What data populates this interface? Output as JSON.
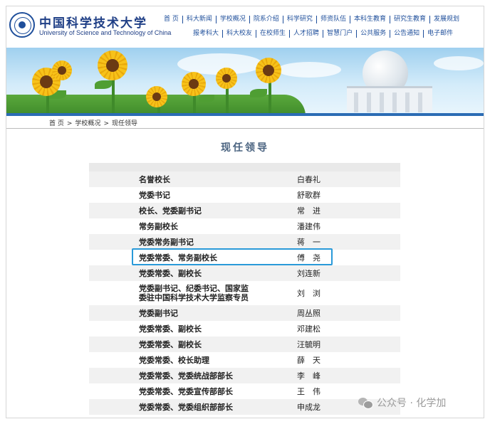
{
  "header": {
    "brand_cn": "中国科学技术大学",
    "brand_en": "University of Science and Technology of China",
    "logo_icon": "ustc-seal-icon"
  },
  "nav": {
    "row1": [
      "首 页",
      "科大新闻",
      "学校概况",
      "院系介绍",
      "科学研究",
      "师资队伍",
      "本科生教育",
      "研究生教育",
      "发展规划"
    ],
    "row2": [
      "报考科大",
      "科大校友",
      "在校师生",
      "人才招聘",
      "智慧门户",
      "公共服务",
      "公告通知",
      "电子邮件"
    ]
  },
  "breadcrumb": [
    "首 页",
    "学校概况",
    "现任领导"
  ],
  "breadcrumb_sep": ">",
  "page_title": "现任领导",
  "leaders": [
    {
      "title": "名誉校长",
      "name": "白春礼"
    },
    {
      "title": "党委书记",
      "name": "舒歌群"
    },
    {
      "title": "校长、党委副书记",
      "name": "常　进"
    },
    {
      "title": "常务副校长",
      "name": "潘建伟"
    },
    {
      "title": "党委常务副书记",
      "name": "蒋　一"
    },
    {
      "title": "党委常委、常务副校长",
      "name": "傅　尧"
    },
    {
      "title": "党委常委、副校长",
      "name": "刘连新"
    },
    {
      "title": "党委副书记、纪委书记、国家监委驻中国科学技术大学监察专员",
      "name": "刘　浏"
    },
    {
      "title": "党委副书记",
      "name": "周丛照"
    },
    {
      "title": "党委常委、副校长",
      "name": "邓建松"
    },
    {
      "title": "党委常委、副校长",
      "name": "汪毓明"
    },
    {
      "title": "党委常委、校长助理",
      "name": "薛　天"
    },
    {
      "title": "党委常委、党委统战部部长",
      "name": "李　峰"
    },
    {
      "title": "党委常委、党委宣传部部长",
      "name": "王　伟"
    },
    {
      "title": "党委常委、党委组织部部长",
      "name": "申成龙"
    }
  ],
  "watermark": "公众号 · 化学加",
  "colors": {
    "brand_blue": "#1f4f9b",
    "highlight": "#2a9ad9",
    "title": "#4a6380"
  }
}
